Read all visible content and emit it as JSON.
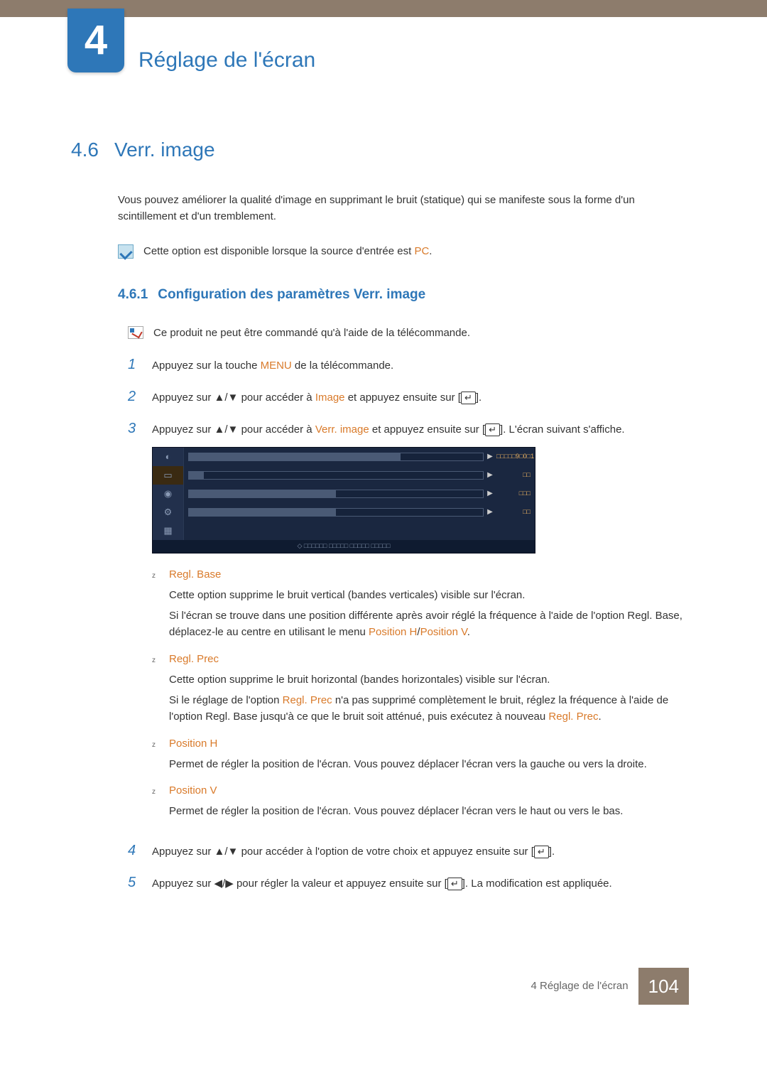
{
  "chapter": {
    "number": "4",
    "title": "Réglage de l'écran"
  },
  "section": {
    "number": "4.6",
    "title": "Verr. image"
  },
  "intro": "Vous pouvez améliorer la qualité d'image en supprimant le bruit (statique) qui se manifeste sous la forme d'un scintillement et d'un tremblement.",
  "note": {
    "prefix": "Cette option est disponible lorsque la source d'entrée est ",
    "hl": "PC",
    "suffix": "."
  },
  "subsection": {
    "number": "4.6.1",
    "title": "Configuration des paramètres Verr. image"
  },
  "info": "Ce produit ne peut être commandé qu'à l'aide de la télécommande.",
  "steps": {
    "s1": {
      "num": "1",
      "pre": "Appuyez sur la touche ",
      "hl": "MENU",
      "post": " de la télécommande."
    },
    "s2": {
      "num": "2",
      "pre": "Appuyez sur ",
      "arrows": "▲/▼",
      "mid": " pour accéder à ",
      "hl": "Image",
      "post1": " et appuyez ensuite sur [",
      "post2": "]."
    },
    "s3": {
      "num": "3",
      "pre": "Appuyez sur ",
      "arrows": "▲/▼",
      "mid": " pour accéder à ",
      "hl": "Verr. image",
      "post1": " et appuyez ensuite sur [",
      "post2": "]. L'écran suivant s'affiche."
    },
    "s4": {
      "num": "4",
      "pre": "Appuyez sur ",
      "arrows": "▲/▼",
      "post1": " pour accéder à l'option de votre choix et appuyez ensuite sur [",
      "post2": "]."
    },
    "s5": {
      "num": "5",
      "pre": "Appuyez sur ",
      "arrows": "◀/▶",
      "post1": " pour régler la valeur et appuyez ensuite sur [",
      "post2": "]. La modification est appliquée."
    }
  },
  "osd": {
    "rows": [
      {
        "value": "□□□□□9□0□1"
      },
      {
        "value": "□□"
      },
      {
        "value": "□□□"
      },
      {
        "value": "□□"
      }
    ],
    "footer": "◇ □□□□□□ □□□□□ □□□□□ □□□□□"
  },
  "bullets": {
    "b1": {
      "label": "Regl. Base",
      "p1": "Cette option supprime le bruit vertical (bandes verticales) visible sur l'écran.",
      "p2a": "Si l'écran se trouve dans une position différente après avoir réglé la fréquence à l'aide de l'option Regl. Base, déplacez-le au centre en utilisant le menu ",
      "p2h1": "Position H",
      "p2sep": "/",
      "p2h2": "Position V",
      "p2end": "."
    },
    "b2": {
      "label": "Regl. Prec",
      "p1": "Cette option supprime le bruit horizontal (bandes horizontales) visible sur l'écran.",
      "p2a": "Si le réglage de l'option ",
      "p2h1": "Regl. Prec",
      "p2b": " n'a pas supprimé complètement le bruit, réglez la fréquence à l'aide de l'option Regl. Base jusqu'à ce que le bruit soit atténué, puis exécutez à nouveau ",
      "p2h2": "Regl. Prec",
      "p2end": "."
    },
    "b3": {
      "label": "Position H",
      "p1": "Permet de régler la position de l'écran. Vous pouvez déplacer l'écran vers la gauche ou vers la droite."
    },
    "b4": {
      "label": "Position V",
      "p1": "Permet de régler la position de l'écran. Vous pouvez déplacer l'écran vers le haut ou vers le bas."
    }
  },
  "footer": {
    "text": "4 Réglage de l'écran",
    "page": "104"
  },
  "glyphs": {
    "enter": "↵",
    "bullet": "z"
  }
}
